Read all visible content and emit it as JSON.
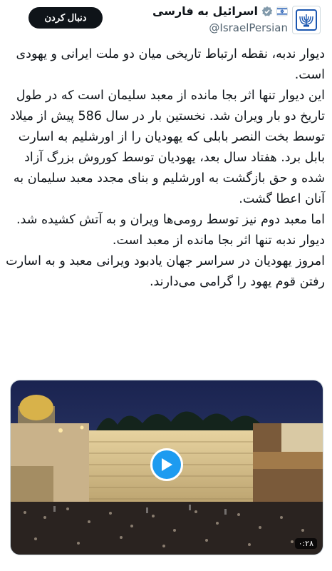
{
  "header": {
    "display_name": "اسرائیل به فارسی",
    "handle": "@IsraelPersian",
    "follow_label": "دنبال کردن",
    "verified_badge": "gov-verified-icon",
    "avatar_icon": "menorah-emblem-icon"
  },
  "tweet": {
    "paragraphs": [
      "دیوار ندبه، نقطه ارتباط تاریخی میان دو ملت ایرانی و یهودی است.",
      "این دیوار تنها اثر بجا مانده از معبد سلیمان است که در طول تاریخ دو بار ویران شد. نخستین بار در سال 586 پیش از میلاد توسط بخت النصر بابلی که یهودیان را از اورشلیم به اسارت بابل برد. هفتاد سال بعد، یهودیان توسط کوروش بزرگ آزاد شده و حق بازگشت به اورشلیم و بنای مجدد معبد سلیمان به آنان اعطا گشت.",
      "اما معبد دوم نیز توسط رومی‌ها ویران و به آتش کشیده شد. دیوار ندبه تنها اثر بجا مانده از معبد است.",
      "امروز یهودیان در سراسر جهان یادبود ویرانی معبد و به اسارت رفتن قوم یهود را گرامی می‌دارند."
    ]
  },
  "media": {
    "duration": "۰:۲۸",
    "play_icon": "play-icon",
    "colors": {
      "accent": "#1d9bf0",
      "sky": "#1e2a55",
      "stone": "#d7c08a",
      "crowd": "#2a2320"
    }
  }
}
